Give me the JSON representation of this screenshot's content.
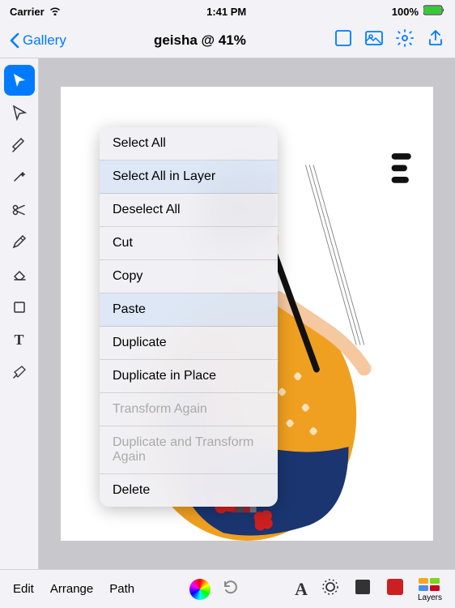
{
  "statusBar": {
    "carrier": "Carrier",
    "wifi": "WiFi",
    "time": "1:41 PM",
    "battery": "100%"
  },
  "navBar": {
    "backLabel": "Gallery",
    "title": "geisha @ 41%",
    "actions": [
      "frame-icon",
      "image-icon",
      "settings-icon",
      "share-icon"
    ]
  },
  "toolbar": {
    "tools": [
      {
        "name": "select-tool",
        "label": "▲",
        "active": true
      },
      {
        "name": "direct-select-tool",
        "label": "✦"
      },
      {
        "name": "pen-tool",
        "label": "✒"
      },
      {
        "name": "add-anchor-tool",
        "label": "✳"
      },
      {
        "name": "scissors-tool",
        "label": "✂"
      },
      {
        "name": "pencil-tool",
        "label": "✏"
      },
      {
        "name": "eraser-tool",
        "label": "◻"
      },
      {
        "name": "shape-tool",
        "label": "⬜"
      },
      {
        "name": "text-tool",
        "label": "T"
      },
      {
        "name": "eyedropper-tool",
        "label": "⌂"
      }
    ]
  },
  "contextMenu": {
    "items": [
      {
        "label": "Select All",
        "enabled": true,
        "highlighted": false
      },
      {
        "label": "Select All in Layer",
        "enabled": true,
        "highlighted": true
      },
      {
        "label": "Deselect All",
        "enabled": true,
        "highlighted": false
      },
      {
        "label": "Cut",
        "enabled": true,
        "highlighted": false
      },
      {
        "label": "Copy",
        "enabled": true,
        "highlighted": false
      },
      {
        "label": "Paste",
        "enabled": true,
        "highlighted": true
      },
      {
        "label": "Duplicate",
        "enabled": true,
        "highlighted": false
      },
      {
        "label": "Duplicate in Place",
        "enabled": true,
        "highlighted": false
      },
      {
        "label": "Transform Again",
        "enabled": false,
        "highlighted": false
      },
      {
        "label": "Duplicate and Transform Again",
        "enabled": false,
        "highlighted": false
      },
      {
        "label": "Delete",
        "enabled": true,
        "highlighted": false
      }
    ]
  },
  "bottomToolbar": {
    "leftItems": [
      {
        "name": "edit-menu",
        "label": "Edit"
      },
      {
        "name": "arrange-menu",
        "label": "Arrange"
      },
      {
        "name": "path-menu",
        "label": "Path"
      }
    ],
    "rightItems": [
      {
        "name": "text-style-btn",
        "label": "A"
      },
      {
        "name": "camera-btn",
        "label": "⊙"
      },
      {
        "name": "layers-icon-btn",
        "label": "⬛"
      },
      {
        "name": "color-swatch-btn",
        "label": "🟥"
      },
      {
        "name": "layers-btn",
        "label": "Layers"
      }
    ]
  }
}
